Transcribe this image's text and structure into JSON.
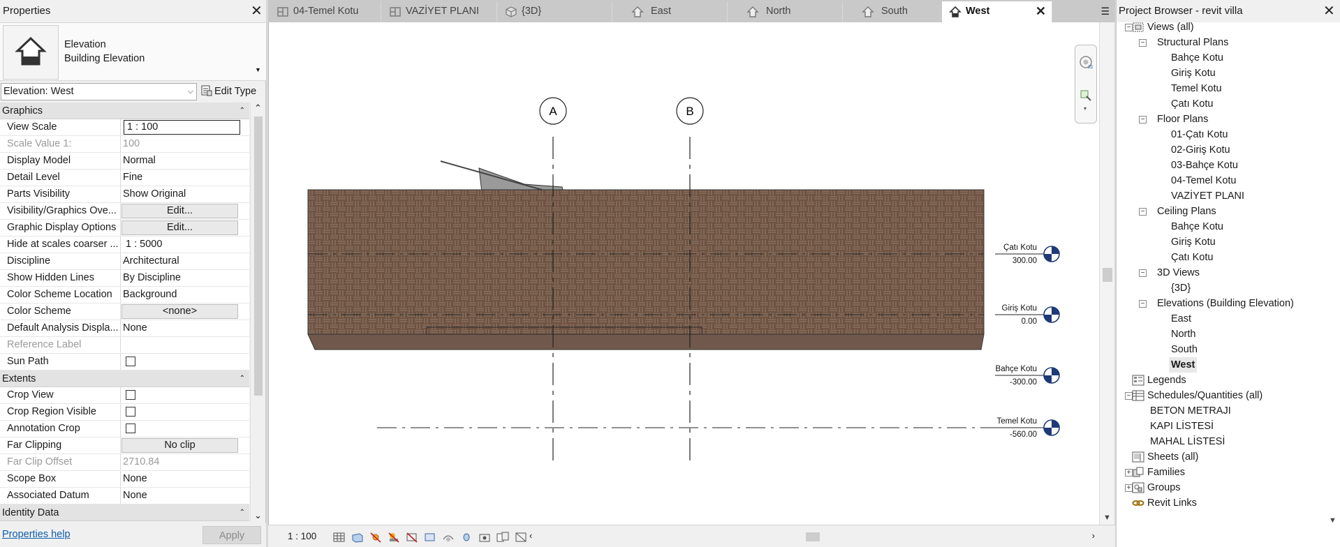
{
  "properties": {
    "title": "Properties",
    "type_family": "Elevation",
    "type_name": "Building Elevation",
    "view_selector": "Elevation: West",
    "edit_type": "Edit Type",
    "groups": {
      "graphics": "Graphics",
      "extents": "Extents",
      "identity": "Identity Data"
    },
    "graphics_rows": [
      {
        "key": "View Scale",
        "value": "1 : 100"
      },
      {
        "key": "Scale Value    1:",
        "value": "100"
      },
      {
        "key": "Display Model",
        "value": "Normal"
      },
      {
        "key": "Detail Level",
        "value": "Fine"
      },
      {
        "key": "Parts Visibility",
        "value": "Show Original"
      },
      {
        "key": "Visibility/Graphics Ove...",
        "value": "Edit..."
      },
      {
        "key": "Graphic Display Options",
        "value": "Edit..."
      },
      {
        "key": "Hide at scales coarser ...",
        "value": "1 : 5000"
      },
      {
        "key": "Discipline",
        "value": "Architectural"
      },
      {
        "key": "Show Hidden Lines",
        "value": "By Discipline"
      },
      {
        "key": "Color Scheme Location",
        "value": "Background"
      },
      {
        "key": "Color Scheme",
        "value": "<none>"
      },
      {
        "key": "Default Analysis Displa...",
        "value": "None"
      },
      {
        "key": "Reference Label",
        "value": ""
      },
      {
        "key": "Sun Path",
        "value": ""
      }
    ],
    "extents_rows": [
      {
        "key": "Crop View",
        "value": ""
      },
      {
        "key": "Crop Region Visible",
        "value": ""
      },
      {
        "key": "Annotation Crop",
        "value": ""
      },
      {
        "key": "Far Clipping",
        "value": "No clip"
      },
      {
        "key": "Far Clip Offset",
        "value": "2710.84"
      },
      {
        "key": "Scope Box",
        "value": "None"
      },
      {
        "key": "Associated Datum",
        "value": "None"
      }
    ],
    "help": "Properties help",
    "apply": "Apply"
  },
  "tabs": [
    {
      "label": "04-Temel Kotu",
      "icon": "floor-plan-icon"
    },
    {
      "label": "VAZİYET PLANI",
      "icon": "floor-plan-icon"
    },
    {
      "label": "{3D}",
      "icon": "cube-3d-icon"
    },
    {
      "label": "East",
      "icon": "elevation-icon"
    },
    {
      "label": "North",
      "icon": "elevation-icon"
    },
    {
      "label": "South",
      "icon": "elevation-icon"
    },
    {
      "label": "West",
      "icon": "elevation-icon"
    }
  ],
  "drawing": {
    "grids": [
      "A",
      "B"
    ],
    "levels": [
      {
        "name": "Çatı Kotu",
        "elev": "300.00"
      },
      {
        "name": "Giriş Kotu",
        "elev": "0.00"
      },
      {
        "name": "Bahçe Kotu",
        "elev": "-300.00"
      },
      {
        "name": "Temel Kotu",
        "elev": "-560.00"
      }
    ],
    "material_color": "#6e5343"
  },
  "view_control": {
    "scale": "1 : 100"
  },
  "browser": {
    "title": "Project Browser - revit villa",
    "nodes": [
      {
        "label": "Views (all)",
        "depth": 0,
        "toggle": "-",
        "icon": "views-icon"
      },
      {
        "label": "Structural Plans",
        "depth": 1,
        "toggle": "-"
      },
      {
        "label": "Bahçe Kotu",
        "depth": 2
      },
      {
        "label": "Giriş Kotu",
        "depth": 2
      },
      {
        "label": "Temel Kotu",
        "depth": 2
      },
      {
        "label": "Çatı Kotu",
        "depth": 2
      },
      {
        "label": "Floor Plans",
        "depth": 1,
        "toggle": "-"
      },
      {
        "label": "01-Çatı Kotu",
        "depth": 2
      },
      {
        "label": "02-Giriş Kotu",
        "depth": 2
      },
      {
        "label": "03-Bahçe Kotu",
        "depth": 2
      },
      {
        "label": "04-Temel Kotu",
        "depth": 2
      },
      {
        "label": "VAZİYET PLANI",
        "depth": 2
      },
      {
        "label": "Ceiling Plans",
        "depth": 1,
        "toggle": "-"
      },
      {
        "label": "Bahçe Kotu",
        "depth": 2
      },
      {
        "label": "Giriş Kotu",
        "depth": 2
      },
      {
        "label": "Çatı Kotu",
        "depth": 2
      },
      {
        "label": "3D Views",
        "depth": 1,
        "toggle": "-"
      },
      {
        "label": "{3D}",
        "depth": 2
      },
      {
        "label": "Elevations (Building Elevation)",
        "depth": 1,
        "toggle": "-"
      },
      {
        "label": "East",
        "depth": 2
      },
      {
        "label": "North",
        "depth": 2
      },
      {
        "label": "South",
        "depth": 2
      },
      {
        "label": "West",
        "depth": 2,
        "selected": true
      },
      {
        "label": "Legends",
        "depth": 0,
        "icon": "legends-icon"
      },
      {
        "label": "Schedules/Quantities (all)",
        "depth": 0,
        "toggle": "-",
        "icon": "schedules-icon"
      },
      {
        "label": "BETON METRAJI",
        "depth": 1
      },
      {
        "label": "KAPI LİSTESİ",
        "depth": 1
      },
      {
        "label": "MAHAL LİSTESİ",
        "depth": 1
      },
      {
        "label": "Sheets (all)",
        "depth": 0,
        "icon": "sheets-icon"
      },
      {
        "label": "Families",
        "depth": 0,
        "toggle": "+",
        "icon": "families-icon"
      },
      {
        "label": "Groups",
        "depth": 0,
        "toggle": "+",
        "icon": "groups-icon"
      },
      {
        "label": "Revit Links",
        "depth": 0,
        "icon": "revit-links-icon"
      }
    ]
  }
}
